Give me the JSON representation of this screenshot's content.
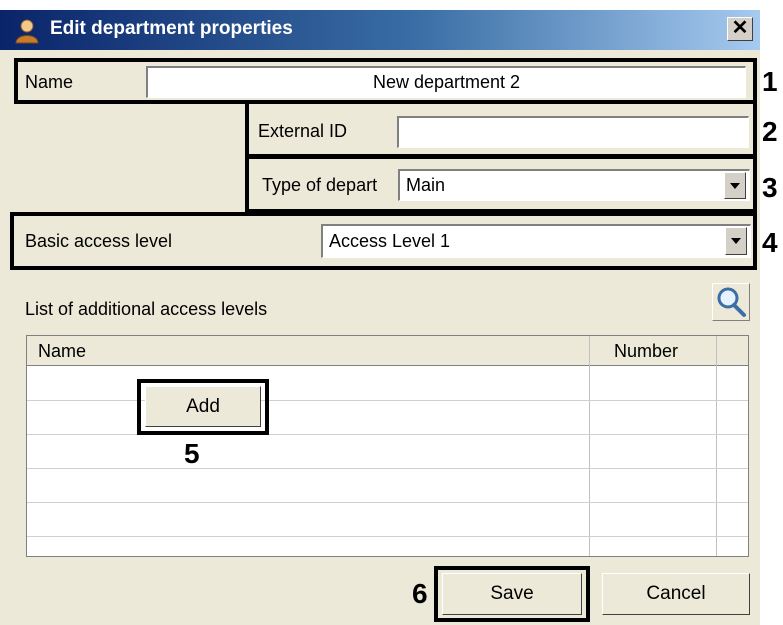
{
  "dialog": {
    "title": "Edit department properties",
    "close_label": "✕"
  },
  "fields": {
    "name_label": "Name",
    "name_value": "New department 2",
    "external_id_label": "External ID",
    "external_id_value": "",
    "type_label": "Type of depart",
    "type_value": "Main",
    "access_label": "Basic access level",
    "access_value": "Access Level 1"
  },
  "list": {
    "title": "List of additional access levels",
    "columns": [
      "Name",
      "Number"
    ],
    "add_label": "Add"
  },
  "buttons": {
    "save_label": "Save",
    "cancel_label": "Cancel"
  },
  "callouts": [
    "1",
    "2",
    "3",
    "4",
    "5",
    "6"
  ],
  "icons": {
    "title": "user-icon",
    "search": "magnifier-icon"
  }
}
